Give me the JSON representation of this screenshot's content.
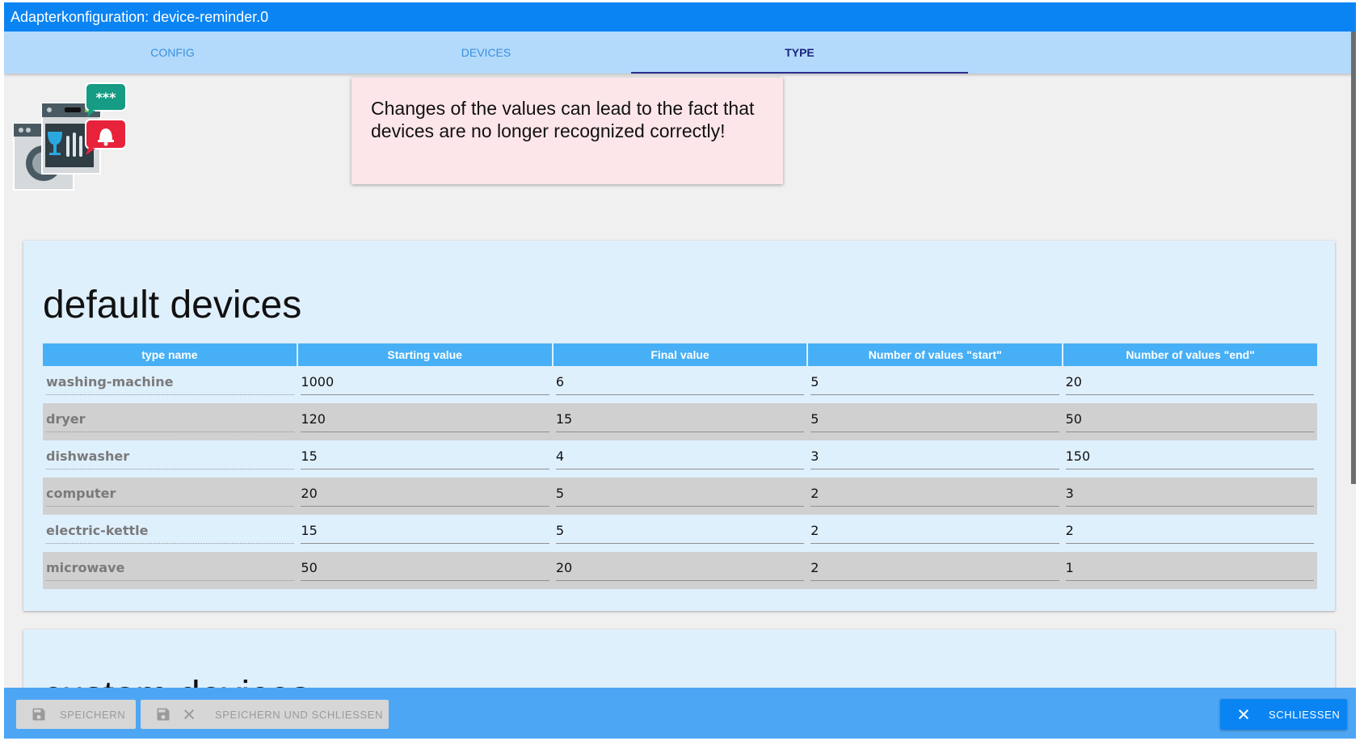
{
  "window": {
    "title": "Adapterkonfiguration: device-reminder.0"
  },
  "tabs": [
    {
      "label": "CONFIG"
    },
    {
      "label": "DEVICES"
    },
    {
      "label": "TYPE"
    }
  ],
  "active_tab": "TYPE",
  "warning": {
    "text": "Changes of the values can lead to the fact that devices are no longer recognized correctly!"
  },
  "default_devices": {
    "title": "default devices",
    "columns": [
      "type name",
      "Starting value",
      "Final value",
      "Number of values \"start\"",
      "Number of values \"end\""
    ],
    "rows": [
      {
        "name": "washing-machine",
        "start": "1000",
        "final": "6",
        "n_start": "5",
        "n_end": "20"
      },
      {
        "name": "dryer",
        "start": "120",
        "final": "15",
        "n_start": "5",
        "n_end": "50"
      },
      {
        "name": "dishwasher",
        "start": "15",
        "final": "4",
        "n_start": "3",
        "n_end": "150"
      },
      {
        "name": "computer",
        "start": "20",
        "final": "5",
        "n_start": "2",
        "n_end": "3"
      },
      {
        "name": "electric-kettle",
        "start": "15",
        "final": "5",
        "n_start": "2",
        "n_end": "2"
      },
      {
        "name": "microwave",
        "start": "50",
        "final": "20",
        "n_start": "2",
        "n_end": "1"
      }
    ]
  },
  "custom_devices": {
    "title": "custom devices"
  },
  "footer": {
    "save_label": "SPEICHERN",
    "save_close_label": "SPEICHERN UND SCHLIESSEN",
    "close_label": "SCHLIESSEN"
  },
  "colors": {
    "titlebar": "#0b84f3",
    "tabbar": "#b3dafb",
    "warning_bg": "#fde6ea",
    "card_bg": "#dff0fd",
    "table_header": "#47aff5",
    "footer": "#4da6f4"
  }
}
